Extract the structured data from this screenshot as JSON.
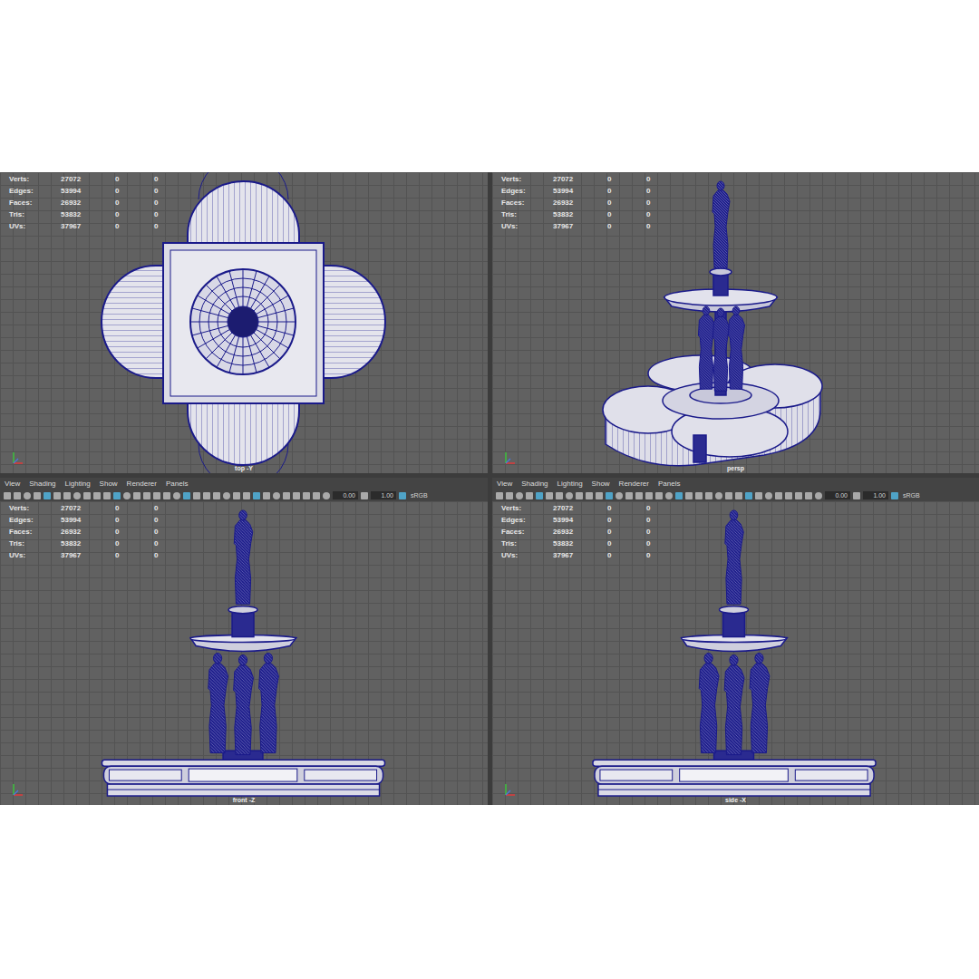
{
  "viewports": [
    {
      "kind": "top",
      "label": "top -Y",
      "menu": [],
      "toolbar": null,
      "stats": [
        {
          "label": "Verts:",
          "values": [
            "27072",
            "0",
            "0"
          ]
        },
        {
          "label": "Edges:",
          "values": [
            "53994",
            "0",
            "0"
          ]
        },
        {
          "label": "Faces:",
          "values": [
            "26932",
            "0",
            "0"
          ]
        },
        {
          "label": "Tris:",
          "values": [
            "53832",
            "0",
            "0"
          ]
        },
        {
          "label": "UVs:",
          "values": [
            "37967",
            "0",
            "0"
          ]
        }
      ]
    },
    {
      "kind": "persp",
      "label": "persp",
      "menu": [],
      "toolbar": null,
      "stats": [
        {
          "label": "Verts:",
          "values": [
            "27072",
            "0",
            "0"
          ]
        },
        {
          "label": "Edges:",
          "values": [
            "53994",
            "0",
            "0"
          ]
        },
        {
          "label": "Faces:",
          "values": [
            "26932",
            "0",
            "0"
          ]
        },
        {
          "label": "Tris:",
          "values": [
            "53832",
            "0",
            "0"
          ]
        },
        {
          "label": "UVs:",
          "values": [
            "37967",
            "0",
            "0"
          ]
        }
      ]
    },
    {
      "kind": "front",
      "label": "front -Z",
      "menu": [
        "View",
        "Shading",
        "Lighting",
        "Show",
        "Renderer",
        "Panels"
      ],
      "toolbar": {
        "fields": [
          "0.00",
          "1.00"
        ],
        "colorspace": "sRGB"
      },
      "stats": [
        {
          "label": "Verts:",
          "values": [
            "27072",
            "0",
            "0"
          ]
        },
        {
          "label": "Edges:",
          "values": [
            "53994",
            "0",
            "0"
          ]
        },
        {
          "label": "Faces:",
          "values": [
            "26932",
            "0",
            "0"
          ]
        },
        {
          "label": "Tris:",
          "values": [
            "53832",
            "0",
            "0"
          ]
        },
        {
          "label": "UVs:",
          "values": [
            "37967",
            "0",
            "0"
          ]
        }
      ]
    },
    {
      "kind": "side",
      "label": "side -X",
      "menu": [
        "View",
        "Shading",
        "Lighting",
        "Show",
        "Renderer",
        "Panels"
      ],
      "toolbar": {
        "fields": [
          "0.00",
          "1.00"
        ],
        "colorspace": "sRGB"
      },
      "stats": [
        {
          "label": "Verts:",
          "values": [
            "27072",
            "0",
            "0"
          ]
        },
        {
          "label": "Edges:",
          "values": [
            "53994",
            "0",
            "0"
          ]
        },
        {
          "label": "Faces:",
          "values": [
            "26932",
            "0",
            "0"
          ]
        },
        {
          "label": "Tris:",
          "values": [
            "53832",
            "0",
            "0"
          ]
        },
        {
          "label": "UVs:",
          "values": [
            "37967",
            "0",
            "0"
          ]
        }
      ]
    }
  ]
}
